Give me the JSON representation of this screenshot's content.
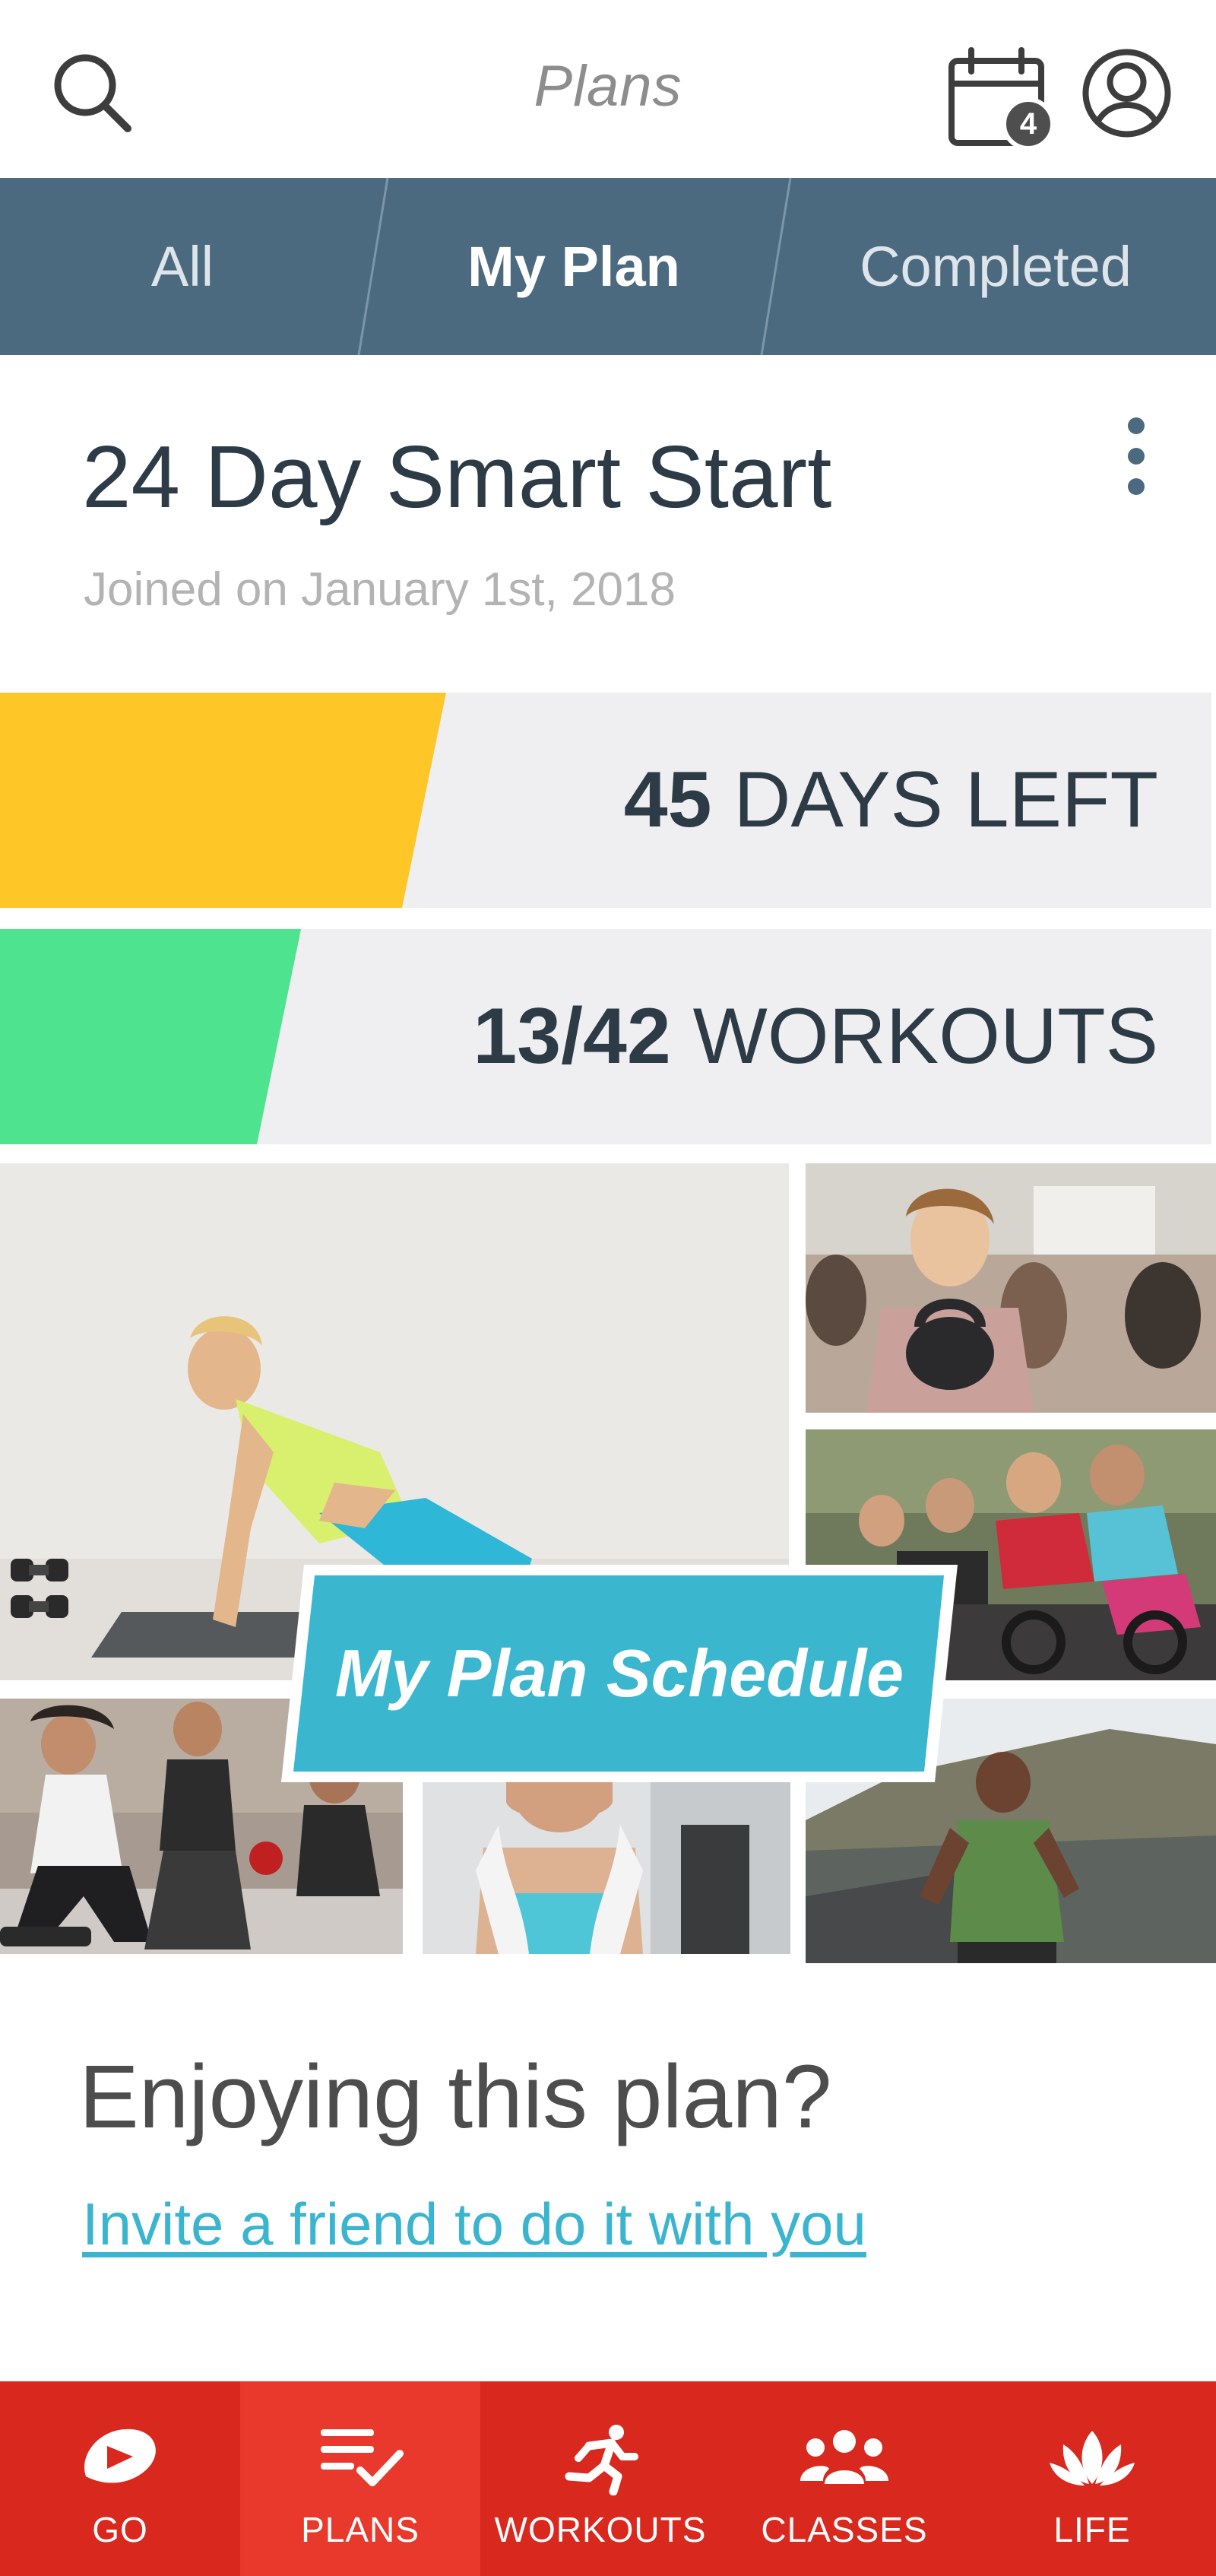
{
  "header": {
    "title": "Plans",
    "calendar_badge": "4"
  },
  "tabs": [
    {
      "label": "All",
      "active": false
    },
    {
      "label": "My Plan",
      "active": true
    },
    {
      "label": "Completed",
      "active": false
    }
  ],
  "plan": {
    "title": "24 Day Smart Start",
    "joined": "Joined on January 1st, 2018"
  },
  "progress": [
    {
      "value": "45",
      "unit": "DAYS LEFT",
      "fraction": 0.35,
      "color": "#fec627"
    },
    {
      "value": "13/42",
      "unit": "WORKOUTS",
      "fraction": 0.23,
      "color": "#4ee38e"
    }
  ],
  "collage": {
    "schedule_label": "My Plan Schedule",
    "accent": "#3ab6cf"
  },
  "invite": {
    "prompt": "Enjoying this plan?",
    "link": "Invite a friend to do it with you"
  },
  "bottom_nav": [
    {
      "label": "GO",
      "icon": "go-icon",
      "active": false
    },
    {
      "label": "PLANS",
      "icon": "plans-icon",
      "active": true
    },
    {
      "label": "WORKOUTS",
      "icon": "runner-icon",
      "active": false
    },
    {
      "label": "CLASSES",
      "icon": "group-icon",
      "active": false
    },
    {
      "label": "LIFE",
      "icon": "lotus-icon",
      "active": false
    }
  ],
  "colors": {
    "tab_bar": "#4c6a7f",
    "nav_bar": "#d9291f",
    "nav_active": "#e8392c",
    "link": "#3ab4cf"
  }
}
